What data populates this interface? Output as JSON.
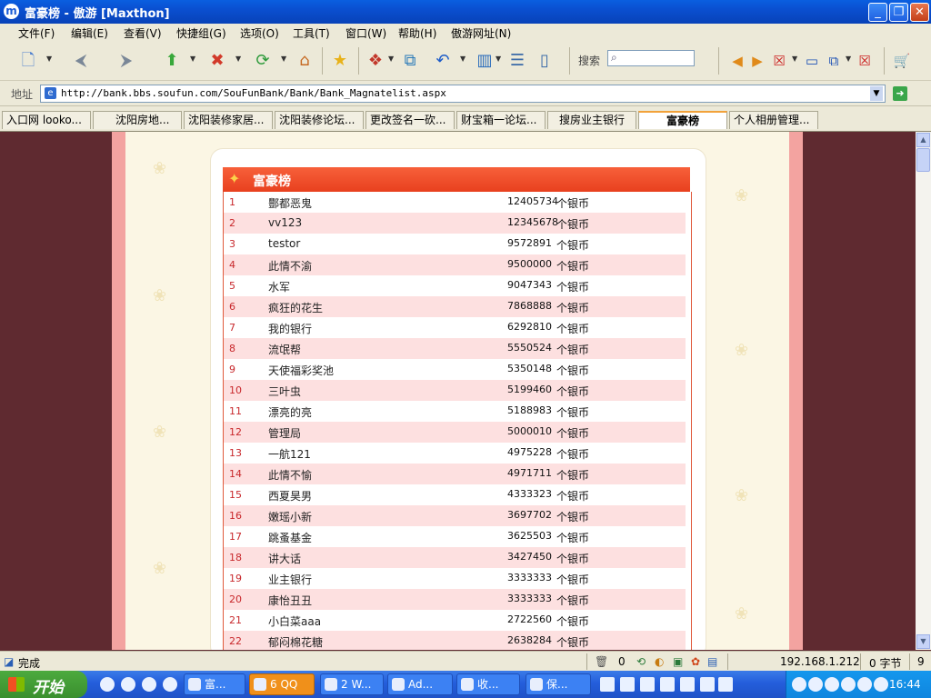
{
  "window": {
    "title": "富豪榜 - 傲游 [Maxthon]",
    "app_icon": "maxthon-logo-icon"
  },
  "menu": [
    "文件(F)",
    "编辑(E)",
    "查看(V)",
    "快捷组(G)",
    "选项(O)",
    "工具(T)",
    "窗口(W)",
    "帮助(H)",
    "傲游网址(N)"
  ],
  "toolbar": {
    "search_label": "搜索"
  },
  "address": {
    "label": "地址",
    "url": "http://bank.bbs.soufun.com/SouFunBank/Bank/Bank_Magnatelist.aspx"
  },
  "tabs": [
    "入口网 looko...",
    "沈阳房地...",
    "沈阳装修家居...",
    "沈阳装修论坛...",
    "更改签名一砍...",
    "财宝箱一论坛...",
    "搜房业主银行",
    "富豪榜",
    "个人相册管理..."
  ],
  "active_tab_index": 7,
  "page": {
    "heading": "富豪榜",
    "unit": "个银币",
    "rows": [
      {
        "rank": "1",
        "name": "酆都恶鬼",
        "amount": "12405734"
      },
      {
        "rank": "2",
        "name": "vv123",
        "amount": "12345678"
      },
      {
        "rank": "3",
        "name": "testor",
        "amount": "9572891"
      },
      {
        "rank": "4",
        "name": "此情不渝",
        "amount": "9500000"
      },
      {
        "rank": "5",
        "name": "水军",
        "amount": "9047343"
      },
      {
        "rank": "6",
        "name": "疯狂的花生",
        "amount": "7868888"
      },
      {
        "rank": "7",
        "name": "我的银行",
        "amount": "6292810"
      },
      {
        "rank": "8",
        "name": "流氓帮",
        "amount": "5550524"
      },
      {
        "rank": "9",
        "name": "天使福彩奖池",
        "amount": "5350148"
      },
      {
        "rank": "10",
        "name": "三叶虫",
        "amount": "5199460"
      },
      {
        "rank": "11",
        "name": "漂亮的亮",
        "amount": "5188983"
      },
      {
        "rank": "12",
        "name": "管理局",
        "amount": "5000010"
      },
      {
        "rank": "13",
        "name": "一航121",
        "amount": "4975228"
      },
      {
        "rank": "14",
        "name": "此情不愉",
        "amount": "4971711"
      },
      {
        "rank": "15",
        "name": "西夏昊男",
        "amount": "4333323"
      },
      {
        "rank": "16",
        "name": "嫩瑶小新",
        "amount": "3697702"
      },
      {
        "rank": "17",
        "name": "跳蚤基金",
        "amount": "3625503"
      },
      {
        "rank": "18",
        "name": "讲大话",
        "amount": "3427450"
      },
      {
        "rank": "19",
        "name": "业主银行",
        "amount": "3333333"
      },
      {
        "rank": "20",
        "name": "康怡丑丑",
        "amount": "3333333"
      },
      {
        "rank": "21",
        "name": "小白菜aaa",
        "amount": "2722560"
      },
      {
        "rank": "22",
        "name": "郁闷棉花糖",
        "amount": "2638284"
      }
    ]
  },
  "status": {
    "text": "完成",
    "count": "0",
    "ip": "192.168.1.212",
    "bytes": "0 字节",
    "num": "9"
  },
  "taskbar": {
    "start": "开始",
    "tasks": [
      "富...",
      "6 QQ",
      "2 W...",
      "Ad...",
      "收...",
      "保..."
    ],
    "clock": "16:44"
  }
}
